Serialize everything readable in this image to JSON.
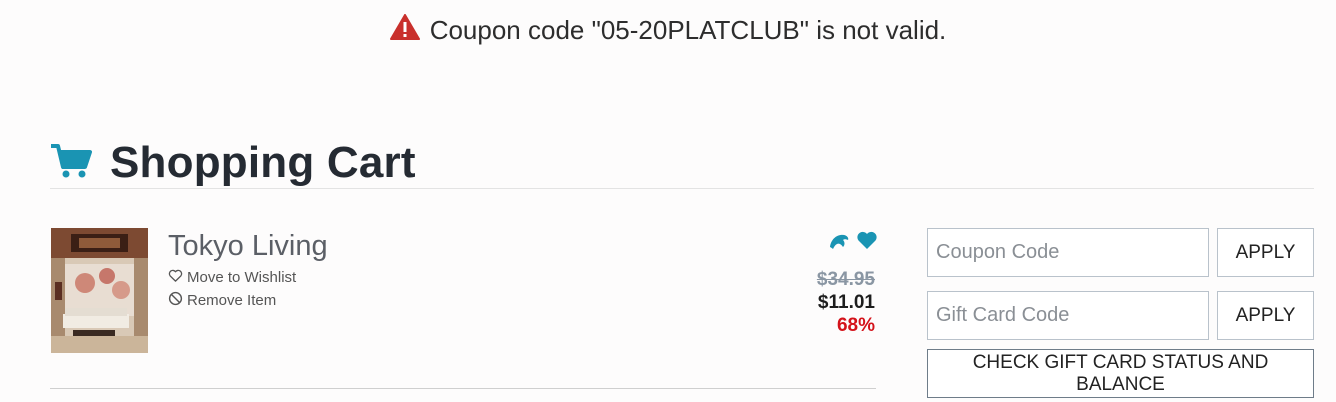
{
  "alert": {
    "icon": "warning-icon",
    "icon_color": "#c9302c",
    "message": "Coupon code \"05-20PLATCLUB\" is not valid."
  },
  "header": {
    "icon": "shopping-cart-icon",
    "icon_color": "#1a94b3",
    "title": "Shopping Cart"
  },
  "cart": {
    "items": [
      {
        "title": "Tokyo Living",
        "thumbnail": "room-scene-image",
        "move_to_wishlist": "Move to Wishlist",
        "remove_item": "Remove Item",
        "badges": [
          "dolphin-icon",
          "heart-icon"
        ],
        "price_original": "$34.95",
        "price_current": "$11.01",
        "discount": "68%"
      }
    ]
  },
  "sidebar": {
    "coupon_placeholder": "Coupon Code",
    "coupon_value": "",
    "coupon_apply": "APPLY",
    "gift_placeholder": "Gift Card Code",
    "gift_value": "",
    "gift_apply": "APPLY",
    "check_gift": "CHECK GIFT CARD STATUS AND BALANCE"
  },
  "colors": {
    "accent": "#1a94b3",
    "discount": "#d4121a",
    "old_price": "#8a96a3"
  }
}
